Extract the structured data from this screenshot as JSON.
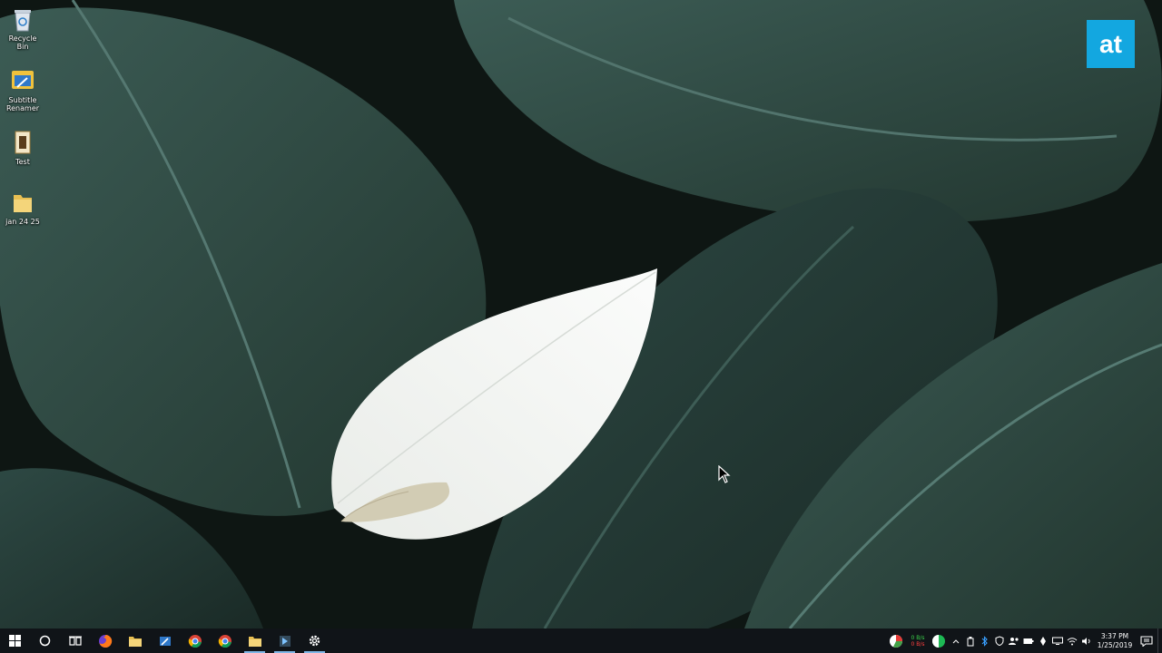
{
  "desktop": {
    "icons": [
      {
        "label": "Recycle Bin",
        "icon": "recycle-bin-icon"
      },
      {
        "label": "Subtitle\nRenamer",
        "icon": "app-icon"
      },
      {
        "label": "Test",
        "icon": "file-icon"
      },
      {
        "label": "jan 24 25",
        "icon": "folder-icon"
      }
    ]
  },
  "watermark": {
    "text": "at",
    "color": "#13a7e0"
  },
  "taskbar": {
    "apps": [
      {
        "icon": "windows-start-icon"
      },
      {
        "icon": "cortana-search-icon"
      },
      {
        "icon": "task-view-icon"
      },
      {
        "icon": "firefox-icon"
      },
      {
        "icon": "file-explorer-icon"
      },
      {
        "icon": "app-icon"
      },
      {
        "icon": "chrome-icon"
      },
      {
        "icon": "chrome-icon"
      },
      {
        "icon": "file-explorer-icon"
      },
      {
        "icon": "app-icon"
      },
      {
        "icon": "settings-gear-icon"
      }
    ],
    "tray": {
      "net_up": "0 B/s",
      "net_down": "0 B/s",
      "time": "3:37 PM",
      "date": "1/25/2019"
    }
  }
}
